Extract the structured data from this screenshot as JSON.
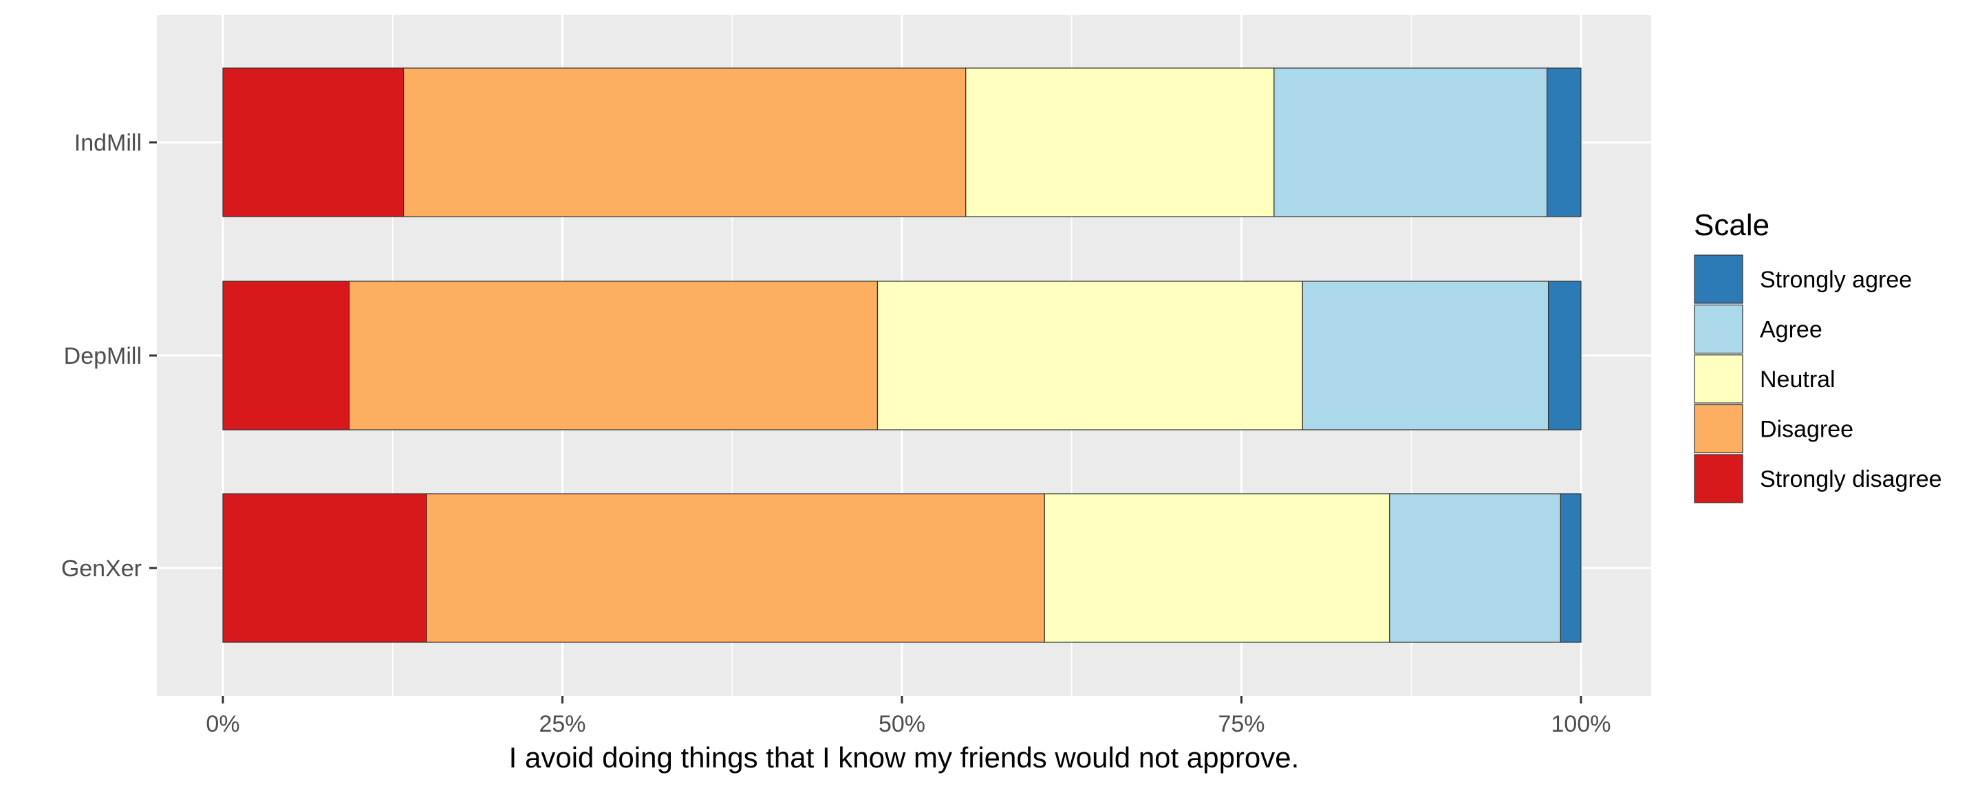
{
  "chart_data": {
    "type": "bar",
    "orientation": "horizontal",
    "stacked": true,
    "categories": [
      "IndMill",
      "DepMill",
      "GenXer"
    ],
    "series": [
      {
        "name": "Strongly disagree",
        "color": "#d7191c",
        "values": [
          0.133,
          0.093,
          0.15
        ]
      },
      {
        "name": "Disagree",
        "color": "#fdae61",
        "values": [
          0.414,
          0.389,
          0.455
        ]
      },
      {
        "name": "Neutral",
        "color": "#ffffbf",
        "values": [
          0.227,
          0.313,
          0.254
        ]
      },
      {
        "name": "Agree",
        "color": "#abd9e9",
        "values": [
          0.201,
          0.181,
          0.126
        ]
      },
      {
        "name": "Strongly agree",
        "color": "#2c7bb6",
        "values": [
          0.025,
          0.024,
          0.015
        ]
      }
    ],
    "xlabel": "I avoid doing things that I know my friends would not approve.",
    "ylabel": "",
    "xlim": [
      0,
      1
    ],
    "x_ticks": [
      "0%",
      "25%",
      "50%",
      "75%",
      "100%"
    ],
    "grid": true,
    "legend": {
      "title": "Scale",
      "position": "right",
      "order": [
        "Strongly agree",
        "Agree",
        "Neutral",
        "Disagree",
        "Strongly disagree"
      ]
    }
  }
}
